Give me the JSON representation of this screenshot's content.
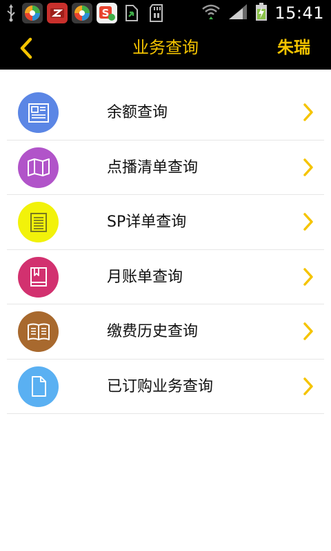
{
  "status_bar": {
    "time": "15:41",
    "left_icons": [
      "usb-icon",
      "app-360-icon",
      "z-app-icon",
      "app-360-icon",
      "s-app-icon",
      "file-transfer-icon",
      "sd-card-icon"
    ],
    "right_icons": [
      "wifi-icon",
      "signal-icon",
      "battery-charging-icon"
    ]
  },
  "header": {
    "back_icon": "chevron-left-icon",
    "title": "业务查询",
    "user": "朱瑞",
    "accent_color": "#f5c400"
  },
  "menu": {
    "items": [
      {
        "label": "余额查询",
        "icon": "newspaper-icon",
        "color": "#5b86e5"
      },
      {
        "label": "点播清单查询",
        "icon": "map-icon",
        "color": "#b154c9"
      },
      {
        "label": "SP详单查询",
        "icon": "list-icon",
        "color": "#f2f20a"
      },
      {
        "label": "月账单查询",
        "icon": "bookmark-book-icon",
        "color": "#d2316f"
      },
      {
        "label": "缴费历史查询",
        "icon": "open-book-icon",
        "color": "#a8692e"
      },
      {
        "label": "已订购业务查询",
        "icon": "document-icon",
        "color": "#5ab0f2"
      }
    ],
    "chevron_color": "#f5c400"
  }
}
